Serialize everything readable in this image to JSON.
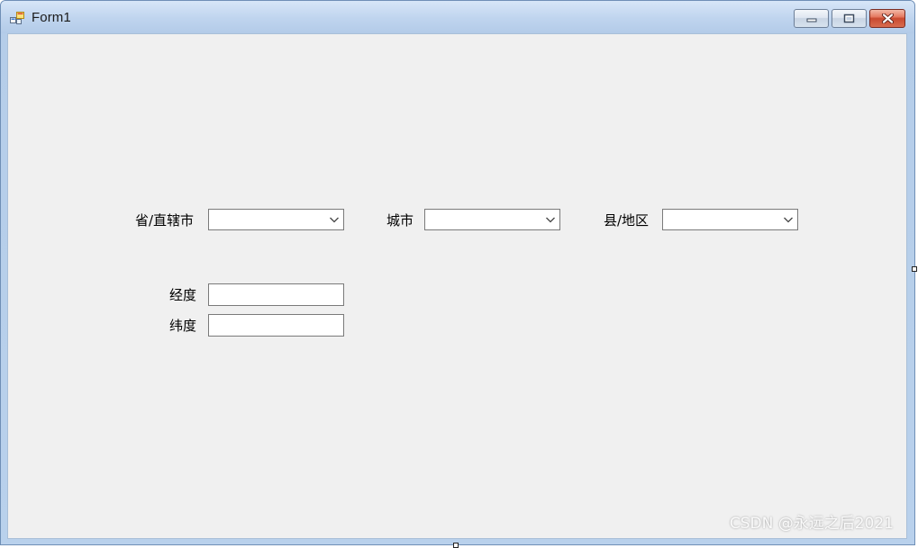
{
  "window": {
    "title": "Form1",
    "controls": {
      "minimize_icon": "minimize-icon",
      "maximize_icon": "restore-icon",
      "close_icon": "close-icon"
    },
    "accent_color": "#b5cde9",
    "client_bg": "#f0f0f0"
  },
  "form": {
    "province_label": "省/直辖市",
    "province_value": "",
    "city_label": "城市",
    "city_value": "",
    "county_label": "县/地区",
    "county_value": "",
    "longitude_label": "经度",
    "longitude_value": "",
    "latitude_label": "纬度",
    "latitude_value": ""
  },
  "watermark": "CSDN @永远之后2021"
}
